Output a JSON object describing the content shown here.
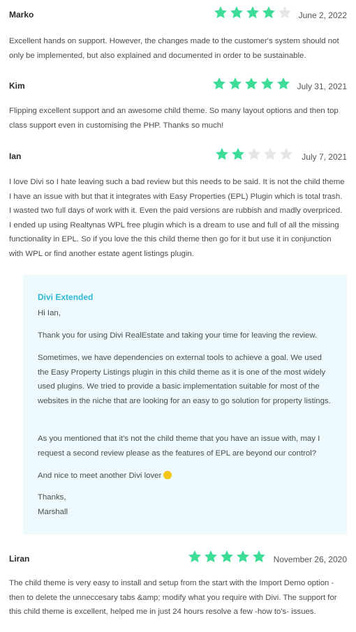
{
  "star_color_filled": "#3ddc97",
  "star_color_empty": "#e6e6e6",
  "reviews": [
    {
      "author": "Marko",
      "rating": 4,
      "date": "June 2, 2022",
      "text": "Excellent hands on support. However, the changes made to the customer's system should not only be implemented, but also explained and documented in order to be sustainable."
    },
    {
      "author": "Kim",
      "rating": 5,
      "date": "July 31, 2021",
      "text": "Flipping excellent support and an awesome child theme. So many layout options and then top class support even in customising the PHP. Thanks so much!"
    },
    {
      "author": "Ian",
      "rating": 2,
      "date": "July 7, 2021",
      "text": "I love Divi so I hate leaving such a bad review but this needs to be said. It is not the child theme I have an issue with but that it integrates with Easy Properties (EPL) Plugin which is total trash. I wasted two full days of work with it. Even the paid versions are rubbish and madly overpriced. I ended up using Realtynas WPL free plugin which is a dream to use and full of all the missing functionality in EPL. So if you love the this child theme then go for it but use it in conjunction with WPL or find another estate agent listings plugin."
    },
    {
      "author": "Liran",
      "rating": 5,
      "date": "November 26, 2020",
      "text": "The child theme is very easy to install and setup from the start with the Import Demo option - then to delete the unneccesary tabs &amp; modify what you require with Divi. The support for this child theme is excellent, helped me in just 24 hours resolve a few -how to's- issues."
    }
  ],
  "reply": {
    "author": "Divi Extended",
    "greeting": "Hi Ian,",
    "p1": "Thank you for using Divi RealEstate and taking your time for leaving the review.",
    "p2": "Sometimes, we have dependencies on external tools to achieve a goal. We used the Easy Property Listings plugin in this child theme as it is one of the most widely used plugins. We tried to provide a basic implementation suitable for most of the websites in the niche that are looking for an easy to go solution for property listings.",
    "p3": "As you mentioned that it's not the child theme that you have an issue with, may I request a second review please as the features of EPL are beyond our control?",
    "p4": "And nice to meet another Divi lover",
    "emoji": "grinning-face-emoji",
    "signoff": "Thanks,",
    "signature": "Marshall"
  }
}
